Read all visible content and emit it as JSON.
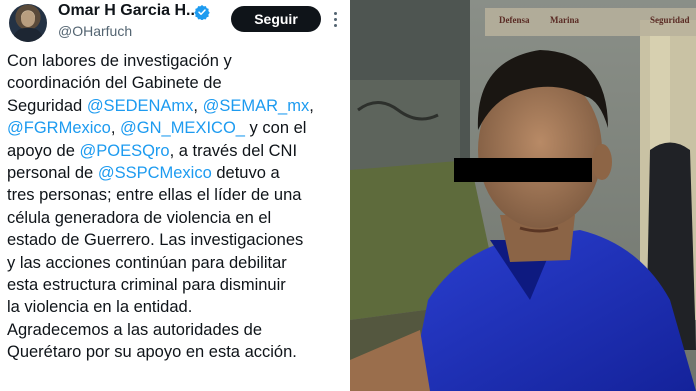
{
  "tweet": {
    "author_name": "Omar H Garcia H...",
    "handle": "@OHarfuch",
    "follow_label": "Seguir",
    "verified_icon": "verified-badge-icon",
    "lines": [
      [
        {
          "t": "Con labores de investigación y"
        }
      ],
      [
        {
          "t": "coordinación del Gabinete de"
        }
      ],
      [
        {
          "t": "Seguridad "
        },
        {
          "t": "@SEDENAmx",
          "m": true
        },
        {
          "t": ", "
        },
        {
          "t": "@SEMAR_mx",
          "m": true
        },
        {
          "t": ","
        }
      ],
      [
        {
          "t": "@FGRMexico",
          "m": true
        },
        {
          "t": ", "
        },
        {
          "t": "@GN_MEXICO_",
          "m": true
        },
        {
          "t": " y con el"
        }
      ],
      [
        {
          "t": "apoyo de "
        },
        {
          "t": "@POESQro",
          "m": true
        },
        {
          "t": ", a través del CNI"
        }
      ],
      [
        {
          "t": "personal de "
        },
        {
          "t": "@SSPCMexico",
          "m": true
        },
        {
          "t": " detuvo a"
        }
      ],
      [
        {
          "t": "tres personas; entre ellas el líder de una"
        }
      ],
      [
        {
          "t": "célula generadora de violencia en el"
        }
      ],
      [
        {
          "t": "estado de Guerrero. Las investigaciones"
        }
      ],
      [
        {
          "t": "y las acciones continúan para debilitar"
        }
      ],
      [
        {
          "t": "esta estructura criminal para disminuir"
        }
      ],
      [
        {
          "t": "la violencia en la entidad."
        }
      ],
      [
        {
          "t": "Agradecemos a las autoridades de"
        }
      ],
      [
        {
          "t": "Querétaro por su apoyo en esta acción."
        }
      ]
    ]
  },
  "photo": {
    "logos": {
      "defensa": "Defensa",
      "marina": "Marina",
      "seguridad": "Seguridad"
    }
  },
  "colors": {
    "mention": "#1d9bf0",
    "text": "#0f1419",
    "muted": "#536471",
    "shirt": "#1c2fb0"
  }
}
